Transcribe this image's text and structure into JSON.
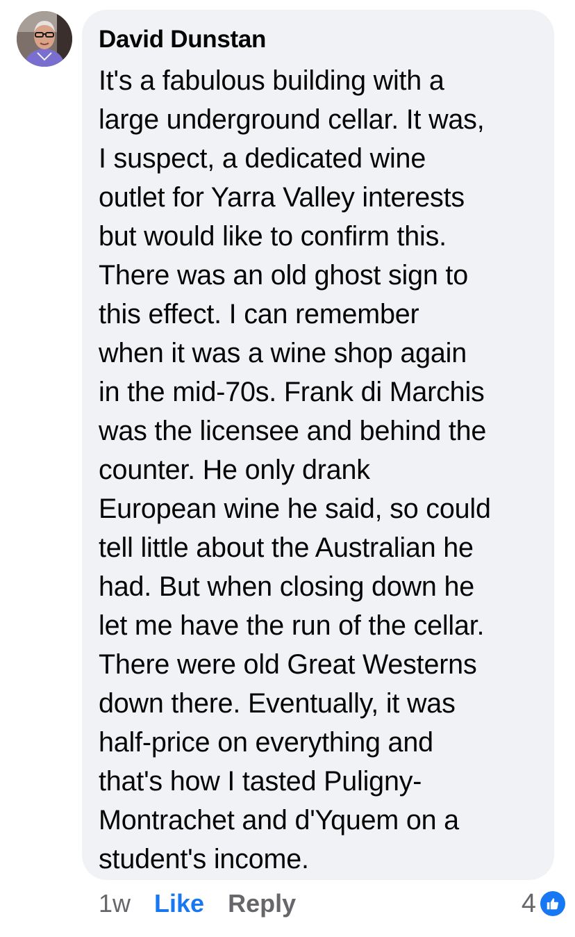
{
  "comment": {
    "author": "David Dunstan",
    "lines": [
      "It's a fabulous building with a",
      "large underground cellar. It was,",
      "I suspect, a dedicated wine",
      "outlet for Yarra Valley interests",
      "but would like to confirm this.",
      "There was an old ghost sign to",
      "this effect. I can remember",
      "when it was a wine shop again",
      "in the mid-70s. Frank di Marchis",
      "was the licensee and behind the",
      "counter. He only drank",
      "European wine he said, so could",
      "tell little about the Australian he",
      "had. But when closing down he",
      "let me have the run of the cellar.",
      "There were old Great Westerns",
      "down there. Eventually, it was",
      "half-price on everything and",
      "that's how I tasted Puligny-",
      "Montrachet and d'Yquem on a",
      "student's income."
    ],
    "timestamp": "1w",
    "like_label": "Like",
    "reply_label": "Reply",
    "reaction_count": "4",
    "reaction_icon": "like-thumb-icon",
    "accent_color": "#1877f2"
  }
}
